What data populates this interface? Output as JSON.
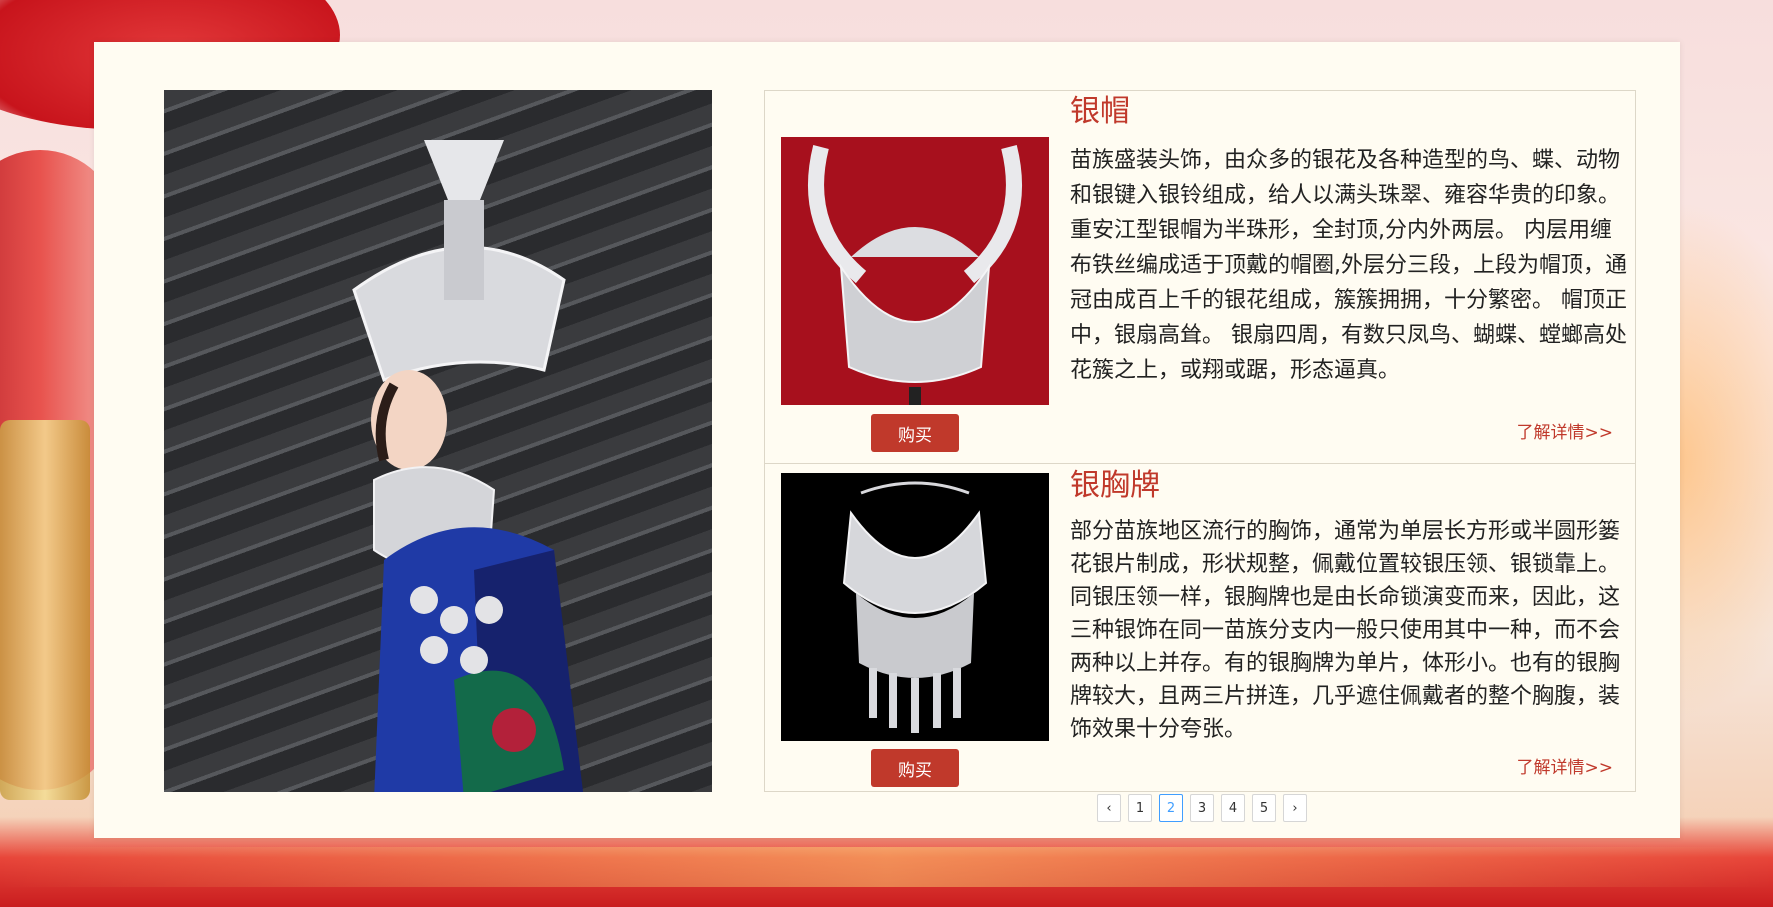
{
  "items": [
    {
      "title": "银帽",
      "description": "苗族盛装头饰，由众多的银花及各种造型的鸟、蝶、动物和银键入银铃组成，给人以满头珠翠、雍容华贵的印象。 重安江型银帽为半珠形，全封顶,分内外两层。 内层用缠布铁丝编成适于顶戴的帽圈,外层分三段，上段为帽顶，通冠由成百上千的银花组成，簇簇拥拥，十分繁密。 帽顶正中，银扇高耸。 银扇四周，有数只凤鸟、蝴蝶、螳螂高处花簇之上，或翔或踞，形态逼真。",
      "buy_label": "购买",
      "more_label": "了解详情>>"
    },
    {
      "title": "银胸牌",
      "description": "部分苗族地区流行的胸饰，通常为单层长方形或半圆形篓花银片制成，形状规整，佩戴位置较银压领、银锁靠上。同银压领一样，银胸牌也是由长命锁演变而来，因此，这三种银饰在同一苗族分支内一般只使用其中一种，而不会两种以上并存。有的银胸牌为单片，体形小。也有的银胸牌较大，且两三片拼连，几乎遮住佩戴者的整个胸腹，装饰效果十分夸张。",
      "buy_label": "购买",
      "more_label": "了解详情>>"
    }
  ],
  "pagination": {
    "prev_icon": "chevron-left-icon",
    "next_icon": "chevron-right-icon",
    "prev_glyph": "‹",
    "next_glyph": "›",
    "pages": [
      "1",
      "2",
      "3",
      "4",
      "5"
    ],
    "current": "2"
  },
  "colors": {
    "accent": "#c0392b",
    "panel": "#fffcf2",
    "active_page": "#409eff"
  }
}
